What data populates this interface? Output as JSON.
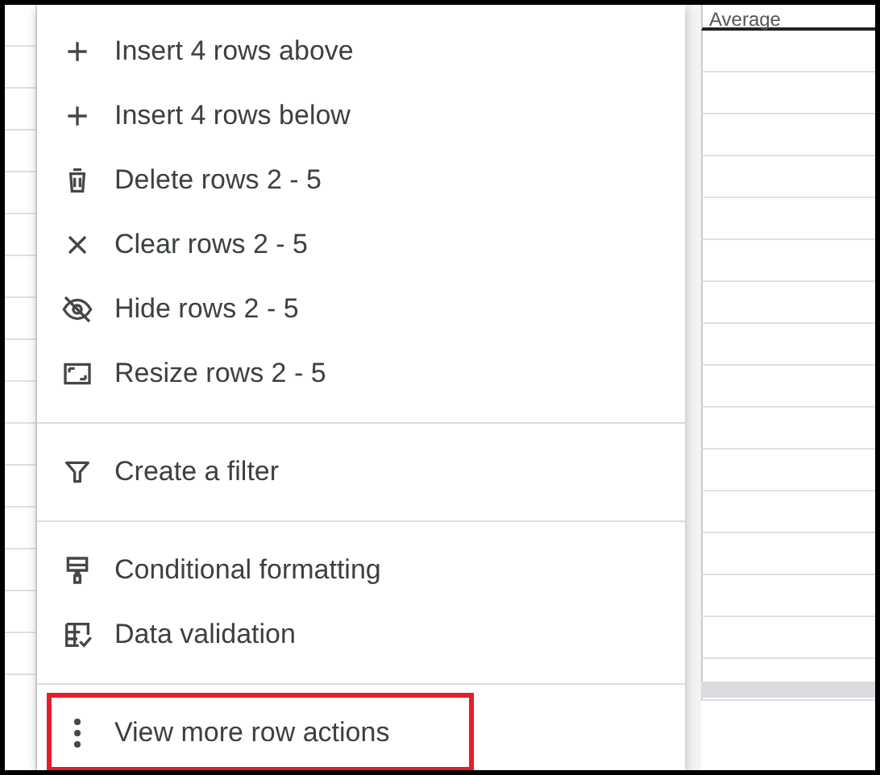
{
  "sheet": {
    "column_header": "Average"
  },
  "context_menu": {
    "sections": [
      [
        {
          "label": "Insert 4 rows above",
          "highlighted": false
        },
        {
          "label": "Insert 4 rows below",
          "highlighted": false
        },
        {
          "label": "Delete rows 2 - 5",
          "highlighted": false
        },
        {
          "label": "Clear rows 2 - 5",
          "highlighted": false
        },
        {
          "label": "Hide rows 2 - 5",
          "highlighted": false
        },
        {
          "label": "Resize rows 2 - 5",
          "highlighted": false
        }
      ],
      [
        {
          "label": "Create a filter",
          "highlighted": false
        }
      ],
      [
        {
          "label": "Conditional formatting",
          "highlighted": false
        },
        {
          "label": "Data validation",
          "highlighted": false
        }
      ],
      [
        {
          "label": "View more row actions",
          "highlighted": true
        }
      ]
    ]
  }
}
